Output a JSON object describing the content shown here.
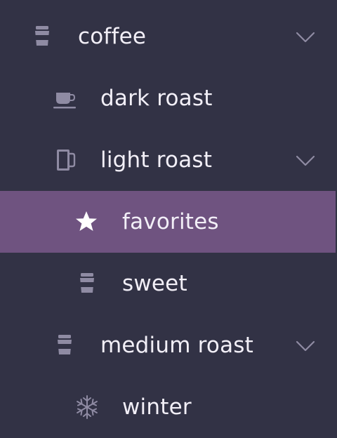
{
  "colors": {
    "background": "#323245",
    "selected_background": "#6f5380",
    "text": "#f2eff7",
    "icon": "#8f8ba3",
    "selected_icon": "#ffffff"
  },
  "tree": {
    "items": [
      {
        "label": "coffee",
        "icon": "takeaway-cup-icon",
        "expanded": true
      },
      {
        "label": "dark roast",
        "icon": "coffee-cup-saucer-icon"
      },
      {
        "label": "light roast",
        "icon": "mug-icon",
        "expanded": true
      },
      {
        "label": "favorites",
        "icon": "star-icon",
        "selected": true
      },
      {
        "label": "sweet",
        "icon": "takeaway-cup-icon"
      },
      {
        "label": "medium roast",
        "icon": "takeaway-cup-icon",
        "expanded": true
      },
      {
        "label": "winter",
        "icon": "snowflake-icon"
      }
    ]
  }
}
